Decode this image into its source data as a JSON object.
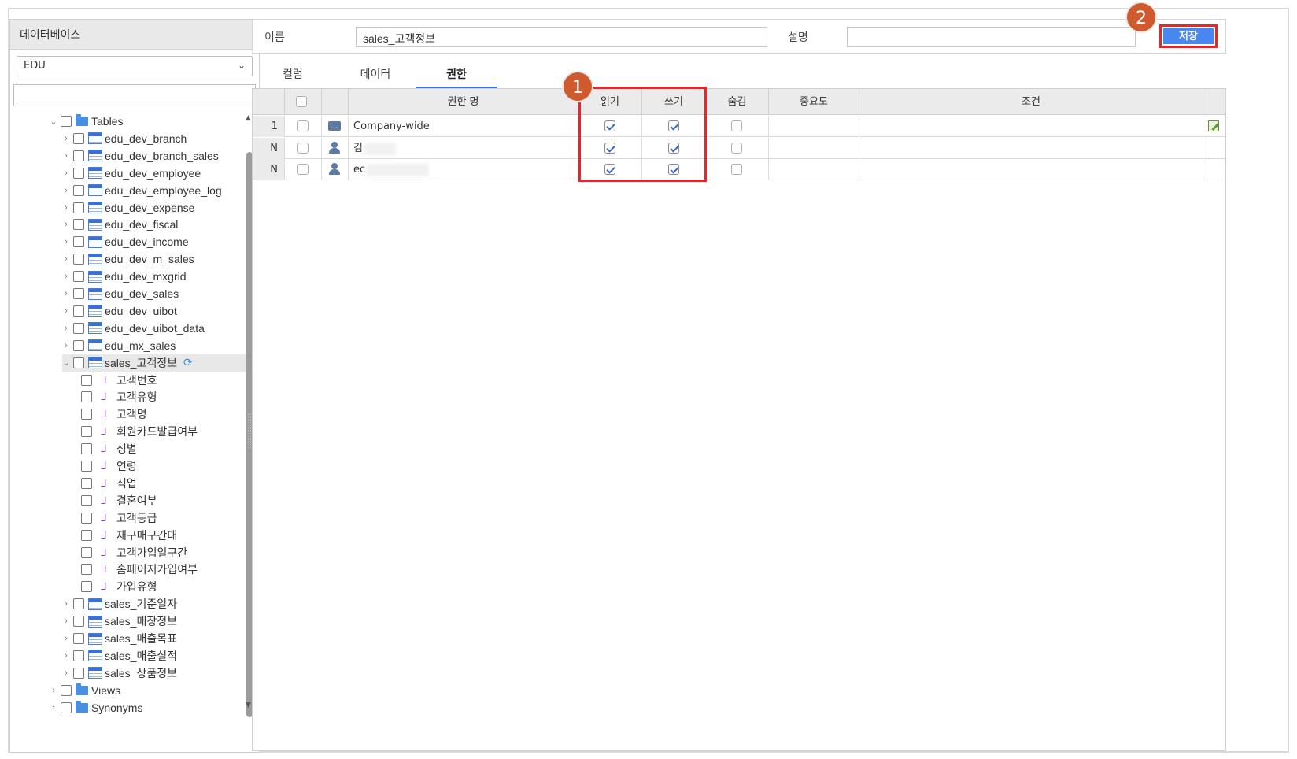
{
  "left": {
    "header": "데이터베이스",
    "db_select": "EDU",
    "tree": {
      "tables_label": "Tables",
      "tables": [
        "edu_dev_branch",
        "edu_dev_branch_sales",
        "edu_dev_employee",
        "edu_dev_employee_log",
        "edu_dev_expense",
        "edu_dev_fiscal",
        "edu_dev_income",
        "edu_dev_m_sales",
        "edu_dev_mxgrid",
        "edu_dev_sales",
        "edu_dev_uibot",
        "edu_dev_uibot_data",
        "edu_mx_sales"
      ],
      "selected_table": "sales_고객정보",
      "columns": [
        "고객번호",
        "고객유형",
        "고객명",
        "회원카드발급여부",
        "성별",
        "연령",
        "직업",
        "결혼여부",
        "고객등급",
        "재구매구간대",
        "고객가입일구간",
        "홈페이지가입여부",
        "가입유형"
      ],
      "tables_after": [
        "sales_기준일자",
        "sales_매장정보",
        "sales_매출목표",
        "sales_매출실적",
        "sales_상품정보"
      ],
      "views_label": "Views",
      "synonyms_label": "Synonyms"
    }
  },
  "props": {
    "name_label": "이름",
    "name_value": "sales_고객정보",
    "desc_label": "설명",
    "desc_value": "",
    "save_label": "저장"
  },
  "badges": {
    "one": "1",
    "two": "2"
  },
  "tabs": [
    "컬럼",
    "데이터",
    "권한"
  ],
  "active_tab": "권한",
  "grid": {
    "headers": {
      "name": "권한 명",
      "read": "읽기",
      "write": "쓰기",
      "hide": "숨김",
      "importance": "중요도",
      "condition": "조건"
    },
    "rows": [
      {
        "num": "1",
        "icon": "message-icon",
        "name": "Company-wide",
        "read": true,
        "write": true,
        "hide": false,
        "edit_icon": true
      },
      {
        "num": "N",
        "icon": "user-icon",
        "name": "김",
        "read": true,
        "write": true,
        "hide": false,
        "edit_icon": false
      },
      {
        "num": "N",
        "icon": "user-icon",
        "name": "ec",
        "read": true,
        "write": true,
        "hide": false,
        "edit_icon": false
      }
    ]
  },
  "colors": {
    "accent": "#4a86f0",
    "highlight": "#e8262a",
    "badge": "#cf5a2d",
    "column_icon": "#8a3fd1"
  }
}
